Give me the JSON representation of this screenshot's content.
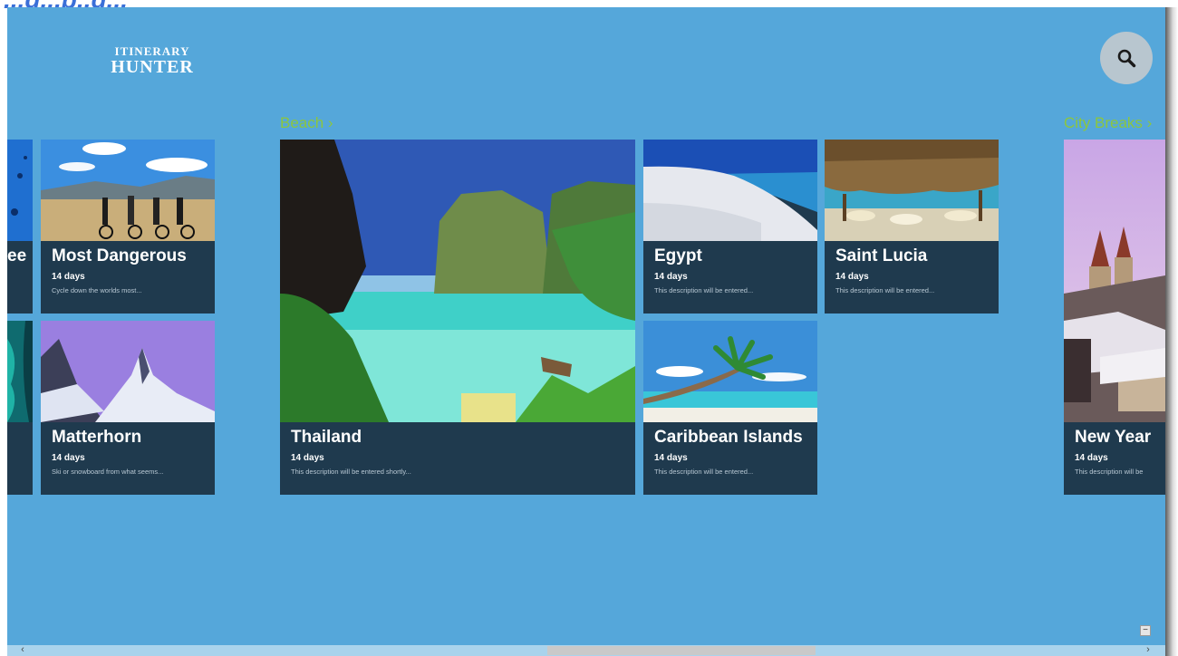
{
  "window": {
    "caption_fragment": "...g...p..g..."
  },
  "app": {
    "logo": {
      "line1": "ITINERARY",
      "line2": "HUNTER"
    },
    "search": {
      "icon": "search-icon"
    }
  },
  "groups": [
    {
      "title": "Beach ›"
    },
    {
      "title": "City Breaks ›"
    }
  ],
  "tiles": {
    "partial_left_top": {
      "title": "ee"
    },
    "most_dangerous": {
      "title": "Most Dangerous",
      "days": "14 days",
      "desc": "Cycle down the worlds most..."
    },
    "matterhorn": {
      "title": "Matterhorn",
      "days": "14 days",
      "desc": "Ski or snowboard from what seems..."
    },
    "thailand": {
      "title": "Thailand",
      "days": "14 days",
      "desc": "This description will be entered shortly..."
    },
    "egypt": {
      "title": "Egypt",
      "days": "14 days",
      "desc": "This description will be entered..."
    },
    "saint_lucia": {
      "title": "Saint Lucia",
      "days": "14 days",
      "desc": "This description will be entered..."
    },
    "caribbean": {
      "title": "Caribbean Islands",
      "days": "14 days",
      "desc": "This description will be entered..."
    },
    "new_year": {
      "title": "New Year",
      "days": "14 days",
      "desc": "This description will be"
    }
  },
  "scrollbar": {
    "left_arrow": "‹",
    "right_arrow": "›",
    "zoom_label": "−"
  },
  "colors": {
    "background": "#55a7da",
    "tile": "#1f3a4e",
    "group_title": "#8cc63f",
    "search_button": "#b8c6cf"
  }
}
